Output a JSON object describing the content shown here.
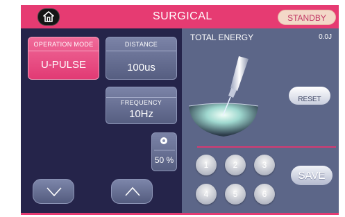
{
  "header": {
    "title": "SURGICAL",
    "status_button": "STANDBY",
    "home_icon": "home-icon"
  },
  "left_panel": {
    "operation_mode": {
      "label": "OPERATION MODE",
      "value": "U-PULSE"
    },
    "distance": {
      "label": "DISTANCE",
      "value": "100us"
    },
    "frequency": {
      "label": "FREQUENCY",
      "value": "10Hz"
    },
    "power": {
      "icon": "power-dot-icon",
      "value": "50 %"
    },
    "down_icon": "chevron-down-icon",
    "up_icon": "chevron-up-icon"
  },
  "right_panel": {
    "total_energy_label": "TOTAL ENERGY",
    "total_energy_value": "0.0J",
    "reset_label": "RESET",
    "keys": [
      "1",
      "2",
      "3",
      "4",
      "5",
      "6"
    ],
    "save_label": "SAVE"
  },
  "colors": {
    "accent_pink": "#e63b72",
    "panel_dark": "#25244a",
    "panel_light": "#5c6688"
  }
}
